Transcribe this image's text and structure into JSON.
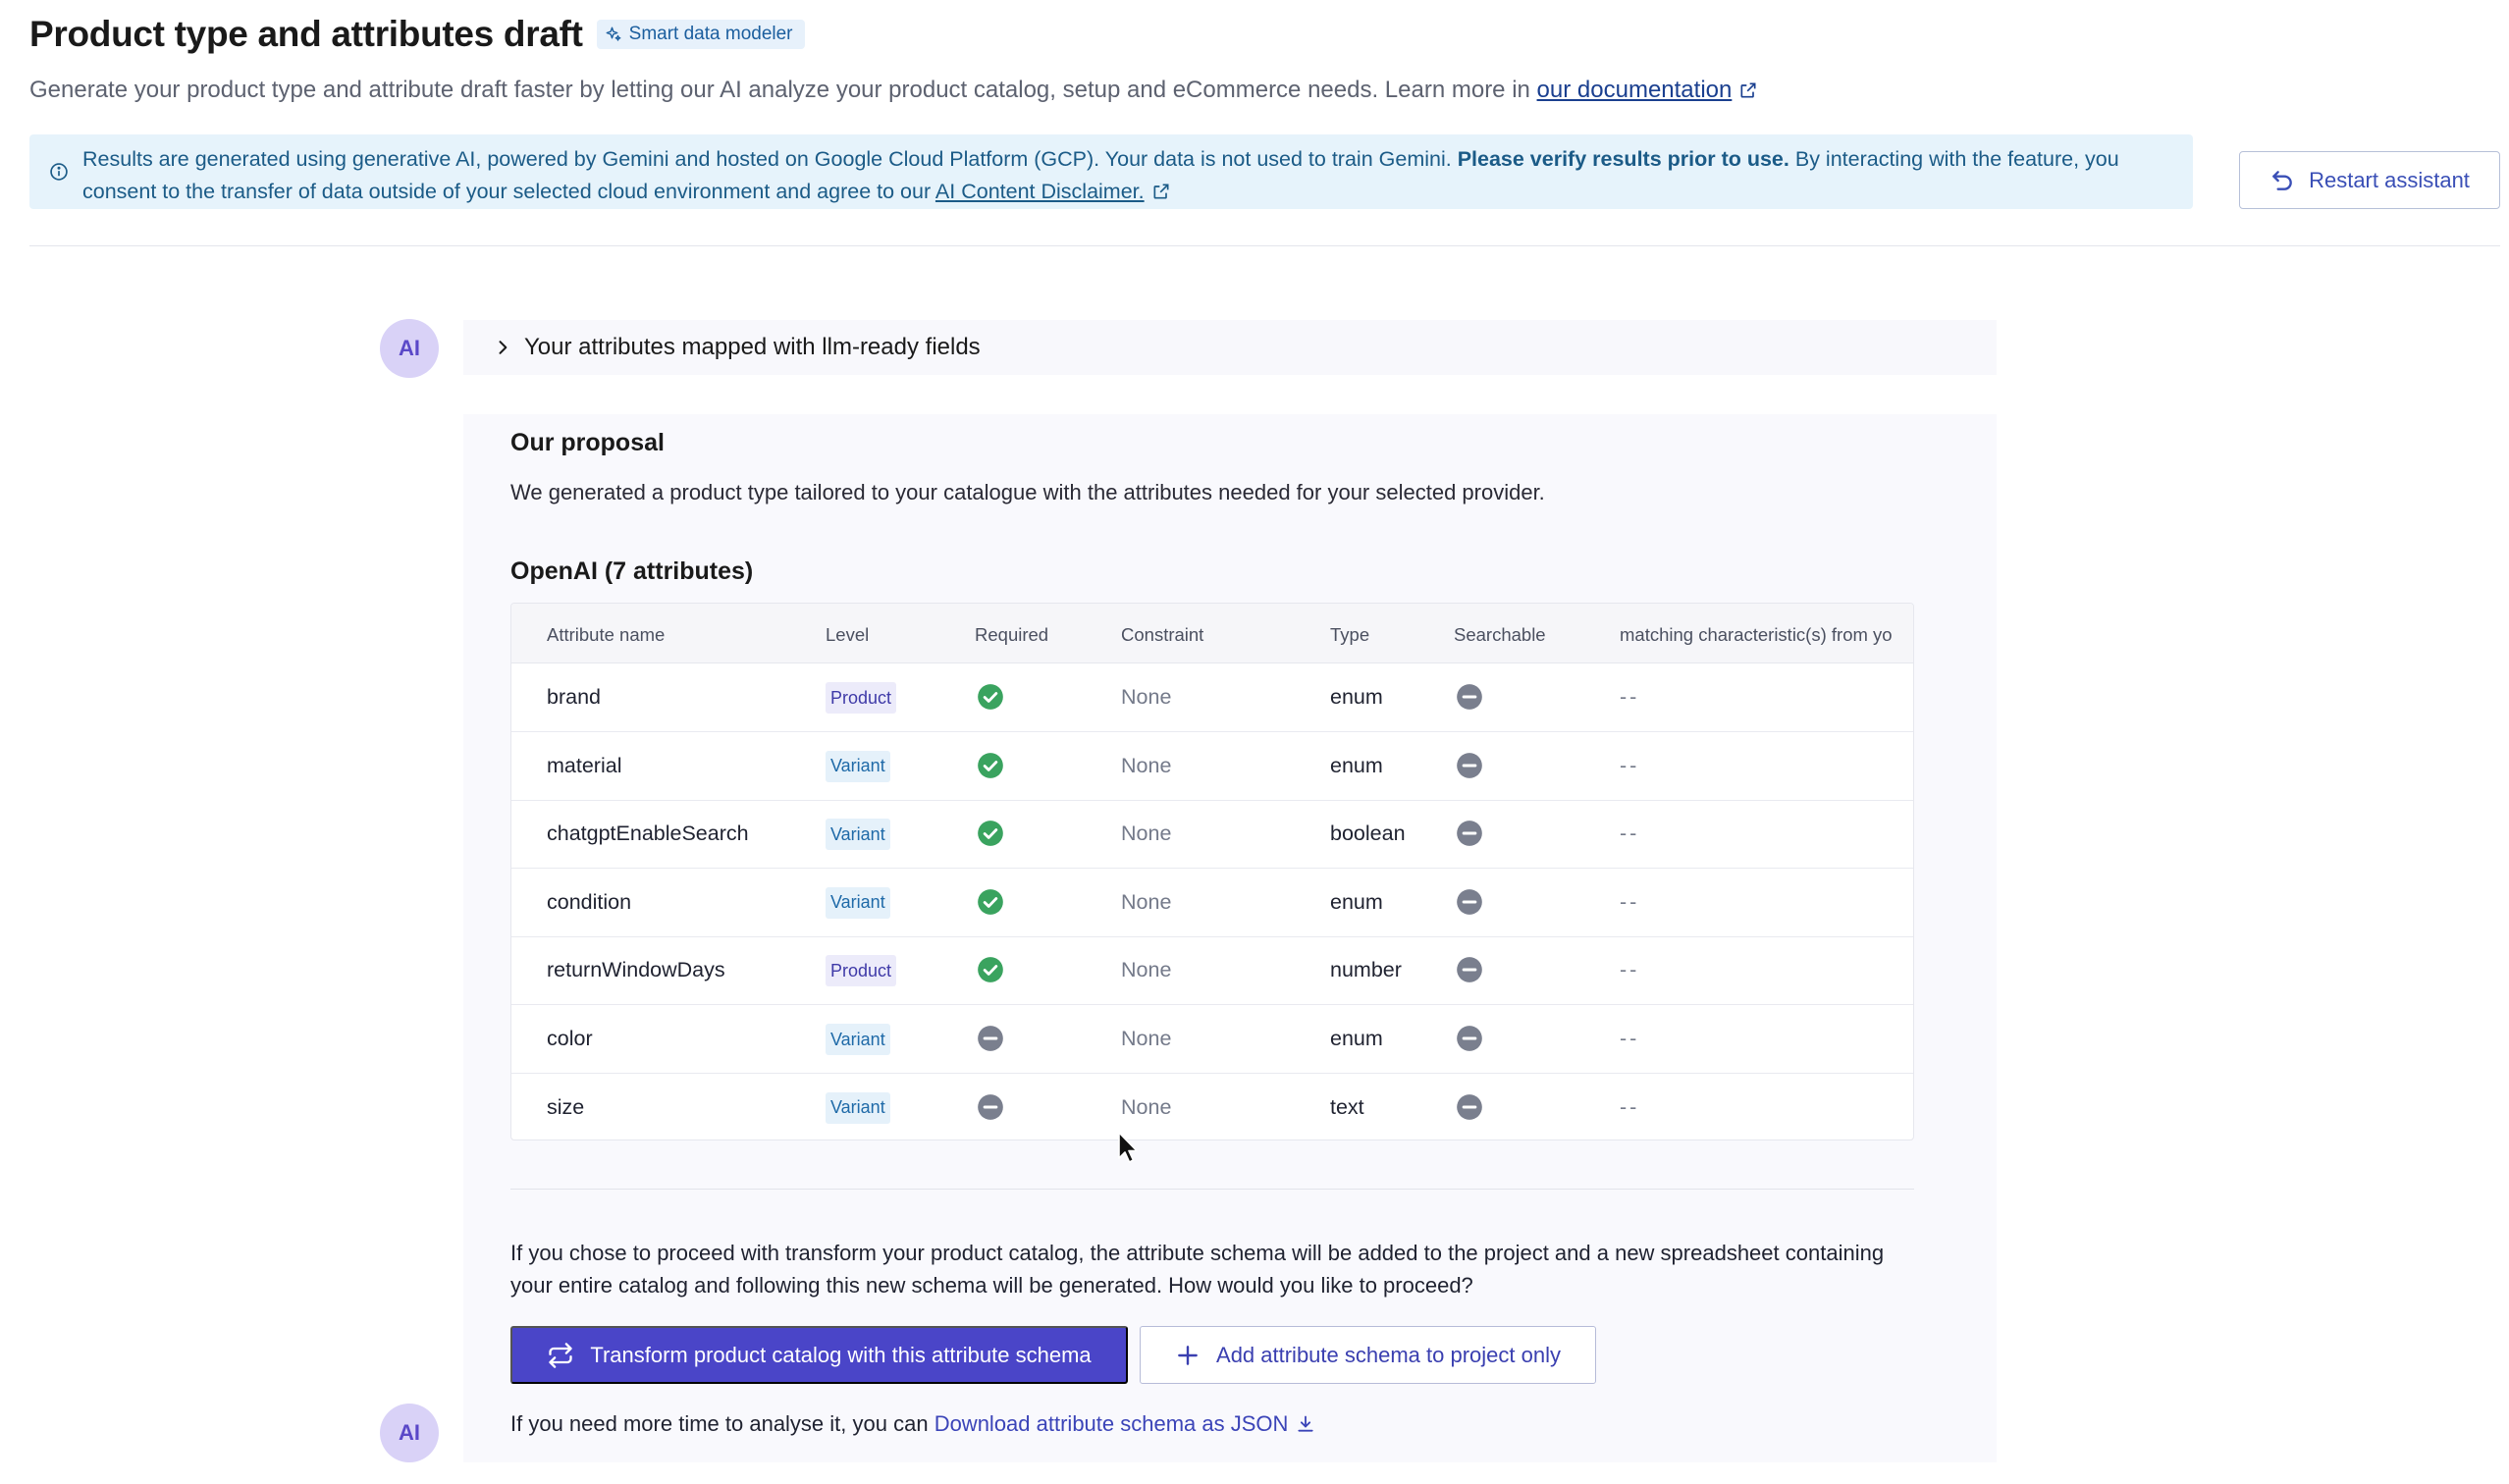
{
  "header": {
    "title": "Product type and attributes draft",
    "badge": "Smart data modeler",
    "subtitle": "Generate your product type and attribute draft faster by letting our AI analyze your product catalog, setup and eCommerce needs. Learn more in ",
    "doc_link": "our documentation"
  },
  "info_banner": {
    "text_1": "Results are generated using generative AI, powered by Gemini and hosted on Google Cloud Platform (GCP). Your data is not used to train Gemini. ",
    "bold": "Please verify results prior to use.",
    "text_2": " By interacting with the feature, you consent to the transfer of data outside of your selected cloud environment and agree to our ",
    "link": "AI Content Disclaimer."
  },
  "restart_button": "Restart assistant",
  "avatar_label": "AI",
  "collapsible_title": "Your attributes mapped with llm-ready fields",
  "proposal": {
    "title": "Our proposal",
    "description": "We generated a product type tailored to your catalogue with the attributes needed for your selected provider.",
    "table_title": "OpenAI (7 attributes)",
    "columns": [
      "Attribute name",
      "Level",
      "Required",
      "Constraint",
      "Type",
      "Searchable",
      "matching characteristic(s) from yo"
    ],
    "rows": [
      {
        "name": "brand",
        "level": "Product",
        "required": true,
        "constraint": "None",
        "type": "enum",
        "searchable": false,
        "matching": "--"
      },
      {
        "name": "material",
        "level": "Variant",
        "required": true,
        "constraint": "None",
        "type": "enum",
        "searchable": false,
        "matching": "--"
      },
      {
        "name": "chatgptEnableSearch",
        "level": "Variant",
        "required": true,
        "constraint": "None",
        "type": "boolean",
        "searchable": false,
        "matching": "--"
      },
      {
        "name": "condition",
        "level": "Variant",
        "required": true,
        "constraint": "None",
        "type": "enum",
        "searchable": false,
        "matching": "--"
      },
      {
        "name": "returnWindowDays",
        "level": "Product",
        "required": true,
        "constraint": "None",
        "type": "number",
        "searchable": false,
        "matching": "--"
      },
      {
        "name": "color",
        "level": "Variant",
        "required": false,
        "constraint": "None",
        "type": "enum",
        "searchable": false,
        "matching": "--"
      },
      {
        "name": "size",
        "level": "Variant",
        "required": false,
        "constraint": "None",
        "type": "text",
        "searchable": false,
        "matching": "--"
      }
    ],
    "proceed_text": "If you chose to proceed with transform your product catalog, the attribute schema will be added to the project and a new spreadsheet containing your entire catalog and following this new schema will be generated. How would you like to proceed?",
    "primary_button": "Transform product catalog with this attribute schema",
    "secondary_button": "Add attribute schema to project only",
    "download_prefix": "If you need more time to analyse it, you can ",
    "download_link": "Download attribute schema as JSON"
  },
  "colors": {
    "accent": "#4a45c8",
    "check": "#3aa35f",
    "minus": "#7a7f8e",
    "info_bg": "#e6f3fb"
  }
}
